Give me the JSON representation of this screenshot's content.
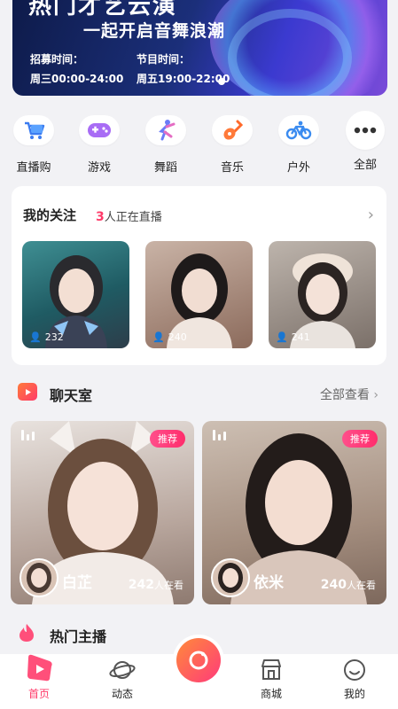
{
  "banner": {
    "title": "热门才艺云演",
    "subtitle": "一起开启音舞浪潮",
    "recruit_label": "招募时间：",
    "recruit_value": "周三00:00-24:00",
    "show_label": "节目时间：",
    "show_value": "周五19:00-22:00"
  },
  "categories": [
    {
      "label": "直播购",
      "icon": "shopping-cart-icon"
    },
    {
      "label": "游戏",
      "icon": "gamepad-icon"
    },
    {
      "label": "舞蹈",
      "icon": "dancer-icon"
    },
    {
      "label": "音乐",
      "icon": "guitar-icon"
    },
    {
      "label": "户外",
      "icon": "bicycle-icon"
    },
    {
      "label": "全部",
      "icon": "more-dots-icon"
    }
  ],
  "follow": {
    "title": "我的关注",
    "live_count": "3",
    "live_suffix": "人正在直播",
    "streamers": [
      {
        "count": "232"
      },
      {
        "count": "240"
      },
      {
        "count": "241"
      }
    ]
  },
  "chat_room": {
    "title": "聊天室",
    "view_all": "全部查看",
    "rooms": [
      {
        "tag": "推荐",
        "name": "白芷",
        "viewers": "242",
        "viewers_suffix": "人在看"
      },
      {
        "tag": "推荐",
        "name": "依米",
        "viewers": "240",
        "viewers_suffix": "人在看"
      }
    ]
  },
  "hot_streamers": {
    "title": "热门主播"
  },
  "tabbar": [
    {
      "label": "首页",
      "icon": "home-play-icon",
      "active": true
    },
    {
      "label": "动态",
      "icon": "planet-icon"
    },
    {
      "label": "",
      "icon": "live-camera-icon"
    },
    {
      "label": "商城",
      "icon": "store-icon"
    },
    {
      "label": "我的",
      "icon": "smile-face-icon"
    }
  ],
  "colors": {
    "accent": "#ff3b6a",
    "brand_pink": "#ff2d6c",
    "background": "#f2f2f5"
  }
}
